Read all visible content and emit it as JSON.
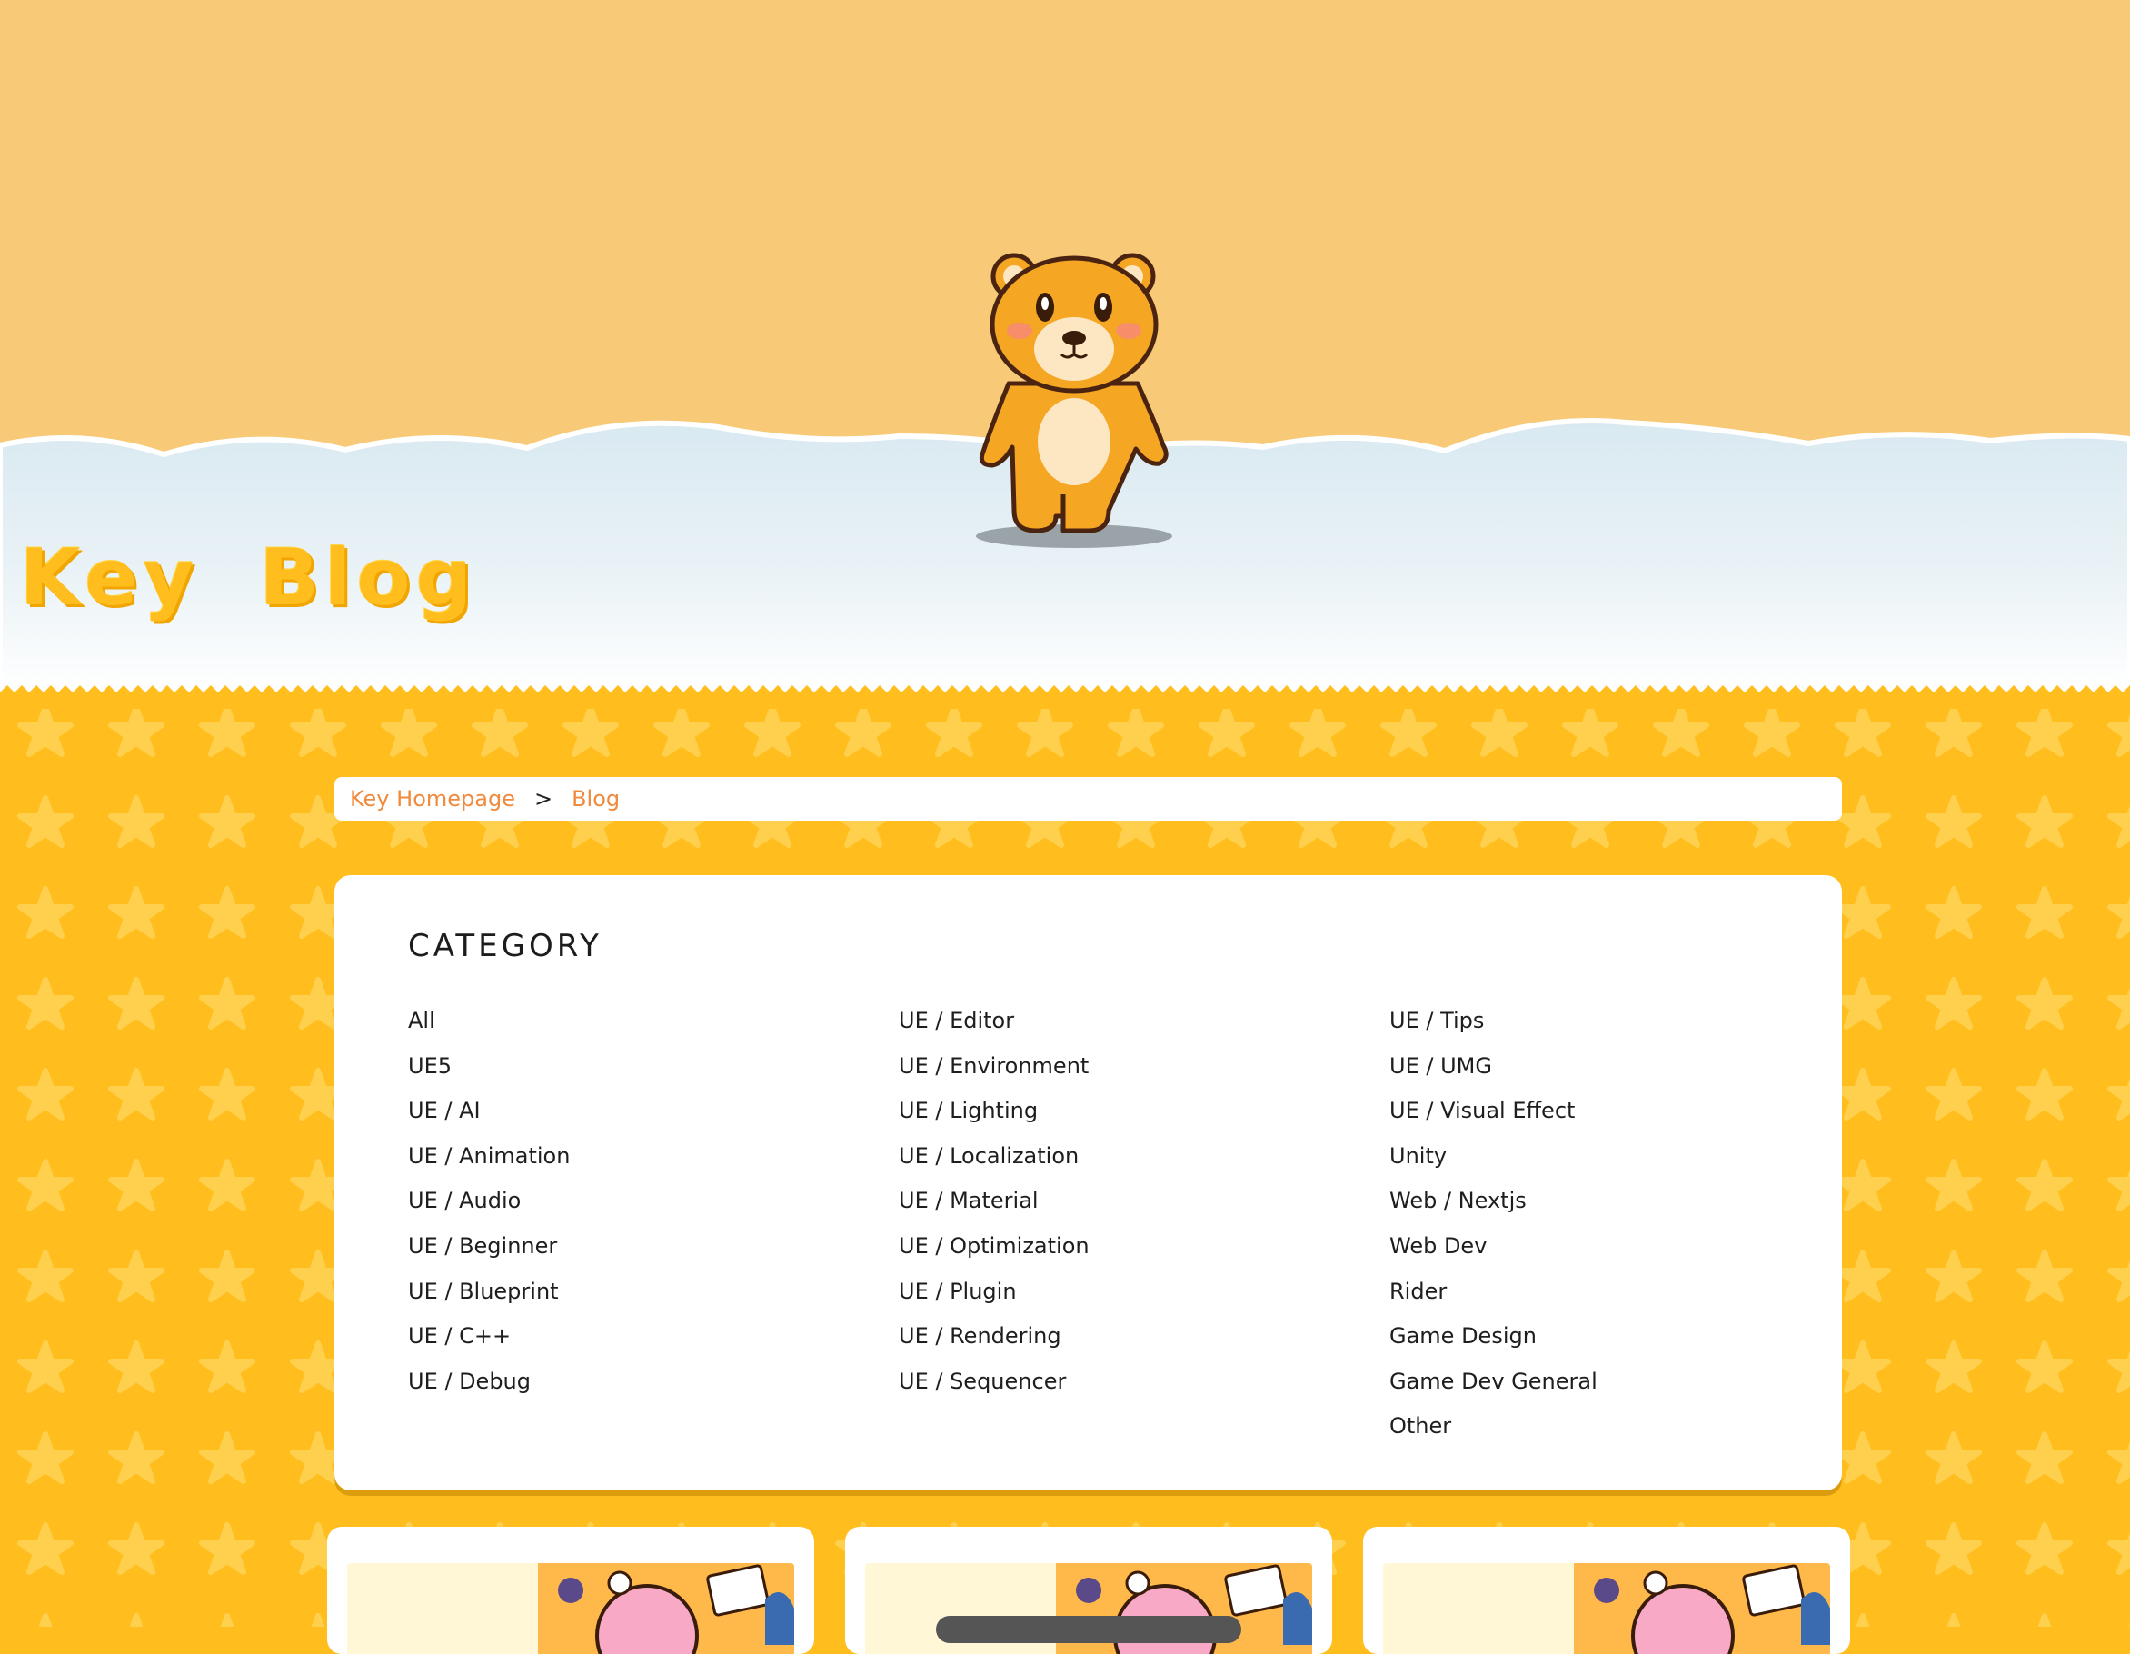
{
  "site": {
    "title": "Key  Blog"
  },
  "breadcrumb": {
    "home": "Key Homepage",
    "separator": ">",
    "current": "Blog"
  },
  "category": {
    "heading": "CATEGORY",
    "columns": [
      [
        "All",
        "UE5",
        "UE / AI",
        "UE / Animation",
        "UE / Audio",
        "UE / Beginner",
        "UE / Blueprint",
        "UE / C++",
        "UE / Debug"
      ],
      [
        "UE / Editor",
        "UE / Environment",
        "UE / Lighting",
        "UE / Localization",
        "UE / Material",
        "UE / Optimization",
        "UE / Plugin",
        "UE / Rendering",
        "UE / Sequencer"
      ],
      [
        "UE / Tips",
        "UE / UMG",
        "UE / Visual Effect",
        "Unity",
        "Web / Nextjs",
        "Web Dev",
        "Rider",
        "Game Design",
        "Game Dev General",
        "Other"
      ]
    ]
  },
  "colors": {
    "header_sky": "#f8c977",
    "cloud": "#e2eef4",
    "page_bg": "#ffbe1e",
    "link": "#f08a3c",
    "bear": "#f5a623"
  },
  "icons": {
    "mascot": "bear-mascot-icon"
  }
}
